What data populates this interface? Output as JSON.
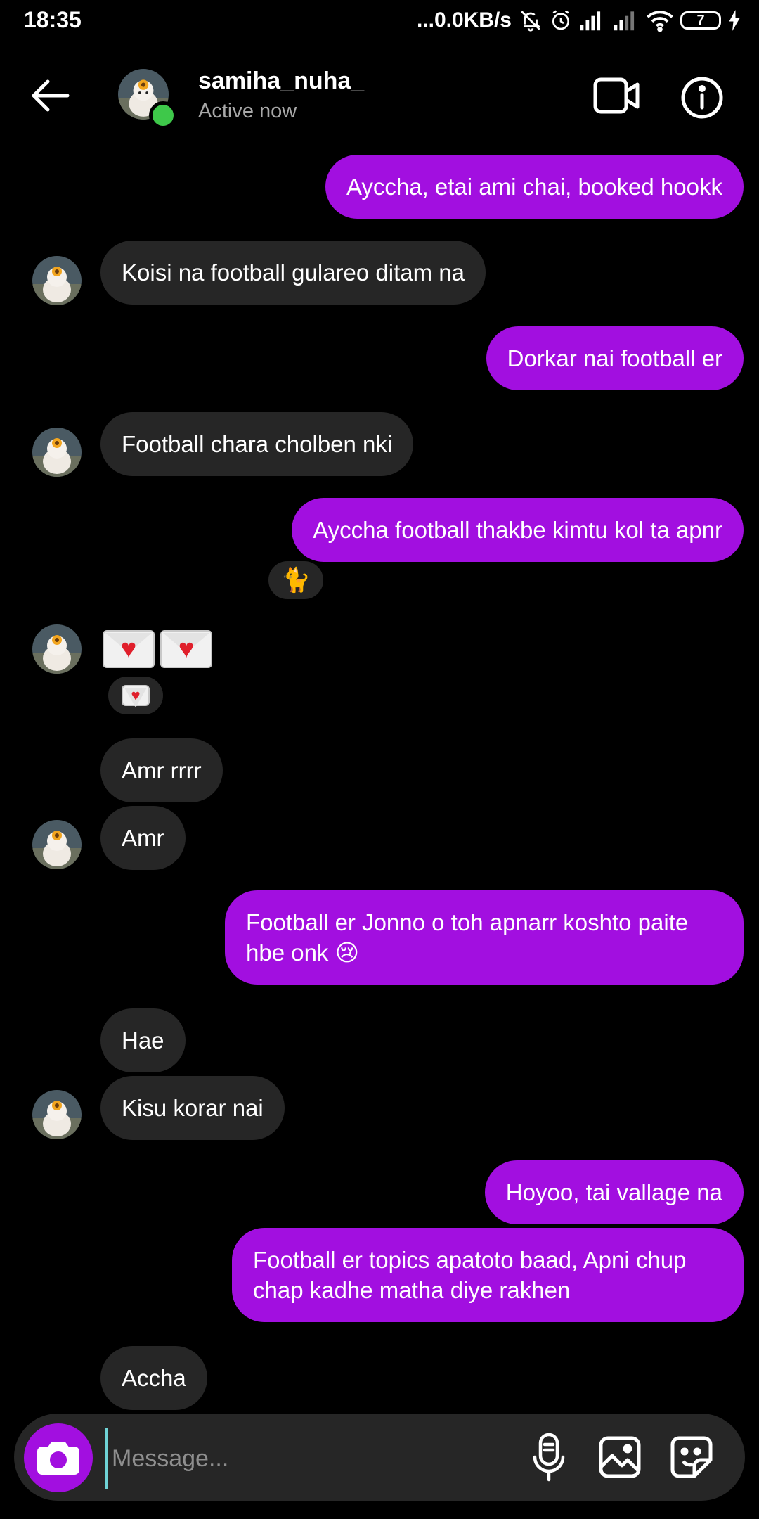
{
  "status_bar": {
    "time": "18:35",
    "network_speed": "...0.0KB/s",
    "battery": "7"
  },
  "header": {
    "username": "samiha_nuha_",
    "status": "Active now",
    "icons": [
      "back-arrow-icon",
      "video-call-icon",
      "info-icon"
    ]
  },
  "messages": [
    {
      "from": "me",
      "text": "Ayccha, etai ami chai, booked hookk"
    },
    {
      "from": "them",
      "text": "Koisi na football gulareo ditam na"
    },
    {
      "from": "me",
      "text": "Dorkar nai football er"
    },
    {
      "from": "them",
      "text": "Football chara cholben nki"
    },
    {
      "from": "me",
      "text": "Ayccha football thakbe kimtu kol ta apnr",
      "reaction": "🐈"
    },
    {
      "from": "them",
      "text": "",
      "emoji": [
        "💌",
        "💌"
      ],
      "reaction": "💌"
    },
    {
      "from": "them",
      "text": "Amr rrrr"
    },
    {
      "from": "them",
      "text": "Amr"
    },
    {
      "from": "me",
      "text": "Football er Jonno o toh apnarr koshto paite hbe onk 😢"
    },
    {
      "from": "them",
      "text": "Hae"
    },
    {
      "from": "them",
      "text": "Kisu korar nai"
    },
    {
      "from": "me",
      "text": "Hoyoo, tai vallage na"
    },
    {
      "from": "me",
      "text": "Football er topics apatoto baad, Apni chup chap kadhe matha diye rakhen"
    },
    {
      "from": "them",
      "text": "Accha"
    }
  ],
  "composer": {
    "placeholder": "Message...",
    "value": ""
  },
  "colors": {
    "background": "#000000",
    "my_bubble": "#a20fe0",
    "their_bubble": "#262626",
    "online": "#3ec84a"
  }
}
